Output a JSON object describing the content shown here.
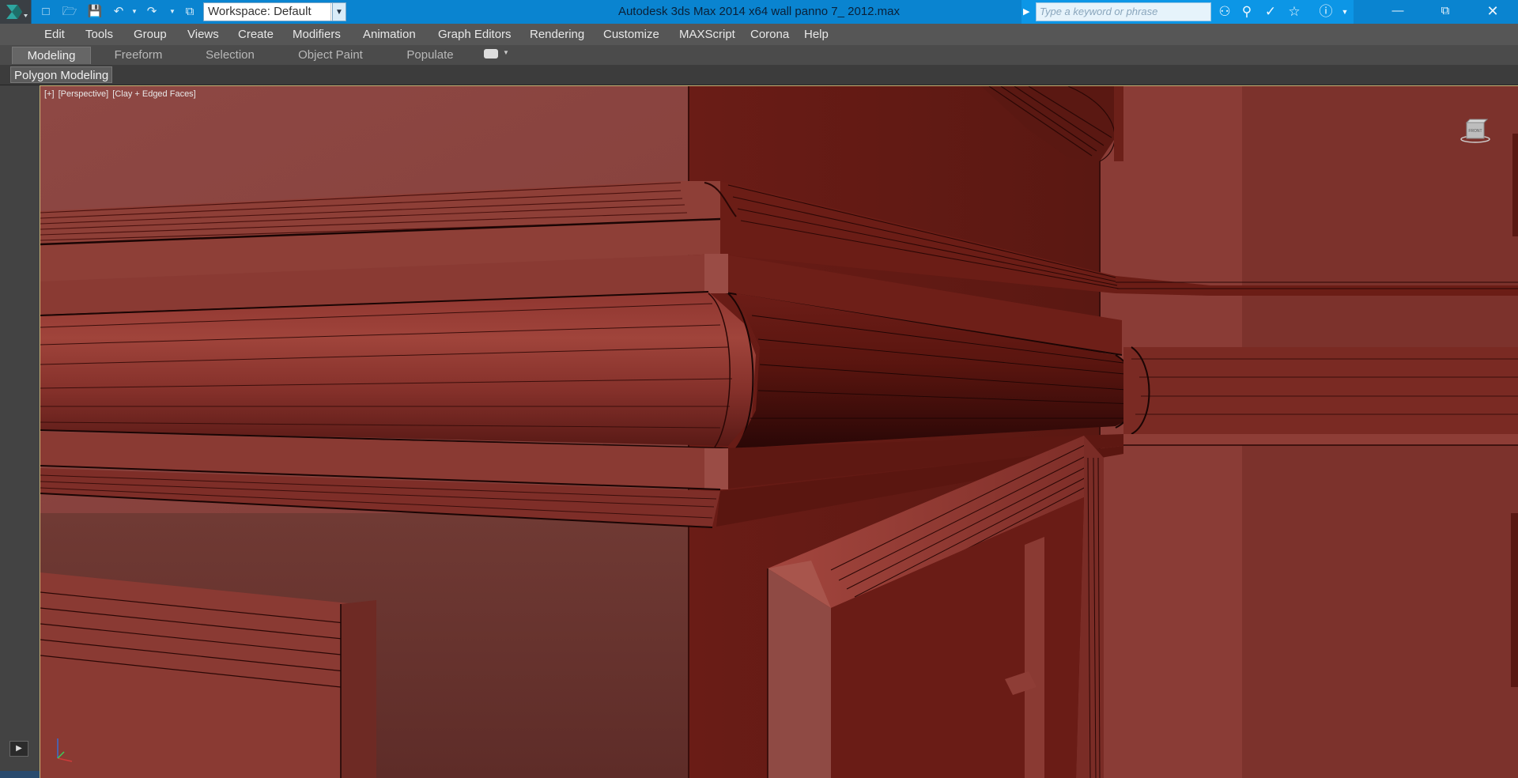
{
  "titlebar": {
    "app_title": "Autodesk 3ds Max  2014 x64      wall panno 7_ 2012.max",
    "workspace_label": "Workspace: Default",
    "search_placeholder": "Type a keyword or phrase",
    "quick_access_icons": [
      "new-icon",
      "open-icon",
      "save-icon",
      "undo-icon",
      "redo-icon",
      "project-icon"
    ],
    "help_icons": [
      "binoculars-icon",
      "subscription-icon",
      "communication-icon",
      "favorites-icon",
      "help-icon"
    ],
    "window_controls": [
      "minimize",
      "restore",
      "close"
    ]
  },
  "menubar": {
    "items": [
      "Edit",
      "Tools",
      "Group",
      "Views",
      "Create",
      "Modifiers",
      "Animation",
      "Graph Editors",
      "Rendering",
      "Customize",
      "MAXScript",
      "Corona",
      "Help"
    ]
  },
  "ribbon": {
    "tabs": [
      "Modeling",
      "Freeform",
      "Selection",
      "Object Paint",
      "Populate"
    ],
    "active_tab": "Modeling",
    "panel_label": "Polygon Modeling"
  },
  "viewport": {
    "label_plus": "[+]",
    "label_view": "[Perspective]",
    "label_shading": "[Clay + Edged Faces]",
    "viewcube_label": "FRONT"
  },
  "colors": {
    "titlebar": "#0a84d0",
    "clay": "#8c3c34",
    "clay_dark": "#5e1a16",
    "menubar": "#565656"
  }
}
